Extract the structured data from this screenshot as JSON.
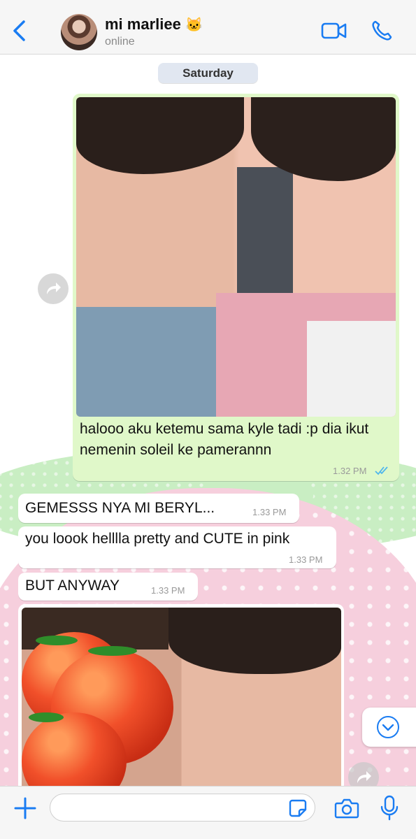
{
  "header": {
    "contact_name": "mi marliee",
    "contact_emoji": "🐱",
    "status": "online",
    "icons": [
      "back-chevron-icon",
      "video-call-icon",
      "phone-call-icon"
    ]
  },
  "date_divider": "Saturday",
  "messages": [
    {
      "direction": "outgoing",
      "has_photo": true,
      "text": "halooo aku ketemu sama kyle tadi :p dia ikut nemenin soleil ke pamerannn",
      "time": "1.32 PM",
      "read": true
    },
    {
      "direction": "incoming",
      "text": "GEMESSS NYA MI BERYL...",
      "time": "1.33 PM"
    },
    {
      "direction": "incoming",
      "text": "you loook helllla pretty and CUTE in pink",
      "time": "1.33 PM"
    },
    {
      "direction": "incoming",
      "text": "BUT ANYWAY",
      "time": "1.33 PM"
    },
    {
      "direction": "incoming",
      "has_photo": true,
      "sticker": "tomatoes"
    }
  ],
  "composer": {
    "placeholder": "",
    "icons": [
      "plus-icon",
      "sticker-icon",
      "camera-icon",
      "microphone-icon"
    ]
  },
  "colors": {
    "accent": "#1a7cf2",
    "outgoing_bubble": "#e0f8c9",
    "incoming_bubble": "#ffffff",
    "read_tick": "#4fb6ec"
  }
}
